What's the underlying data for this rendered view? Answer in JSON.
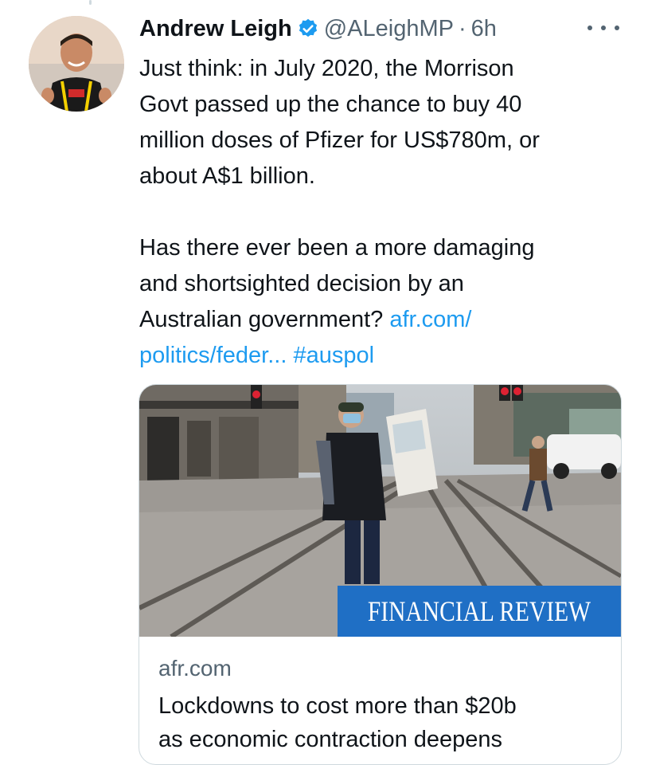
{
  "author": {
    "name": "Andrew Leigh",
    "handle": "@ALeighMP",
    "separator": "·",
    "time": "6h"
  },
  "tweet": {
    "paragraph1": "Just think: in July 2020, the Morrison\nGovt passed up the chance to buy 40\nmillion doses of Pfizer for US$780m, or\nabout A$1 billion.",
    "paragraph2_prefix": "Has there ever been a more damaging\nand shortsighted decision by an\nAustralian government? ",
    "link_text": "afr.com/\npolitics/feder...",
    "hashtag": "#auspol"
  },
  "card": {
    "badge": "FINANCIAL REVIEW",
    "domain": "afr.com",
    "title": "Lockdowns to cost more than $20b\nas economic contraction deepens"
  },
  "colors": {
    "link": "#1d9bf0",
    "secondary_text": "#536471",
    "verified_badge": "#1d9bf0",
    "afr_badge": "#1f6fc5"
  },
  "icons": {
    "verified": "verified-badge-icon",
    "more": "more-dots-icon"
  }
}
